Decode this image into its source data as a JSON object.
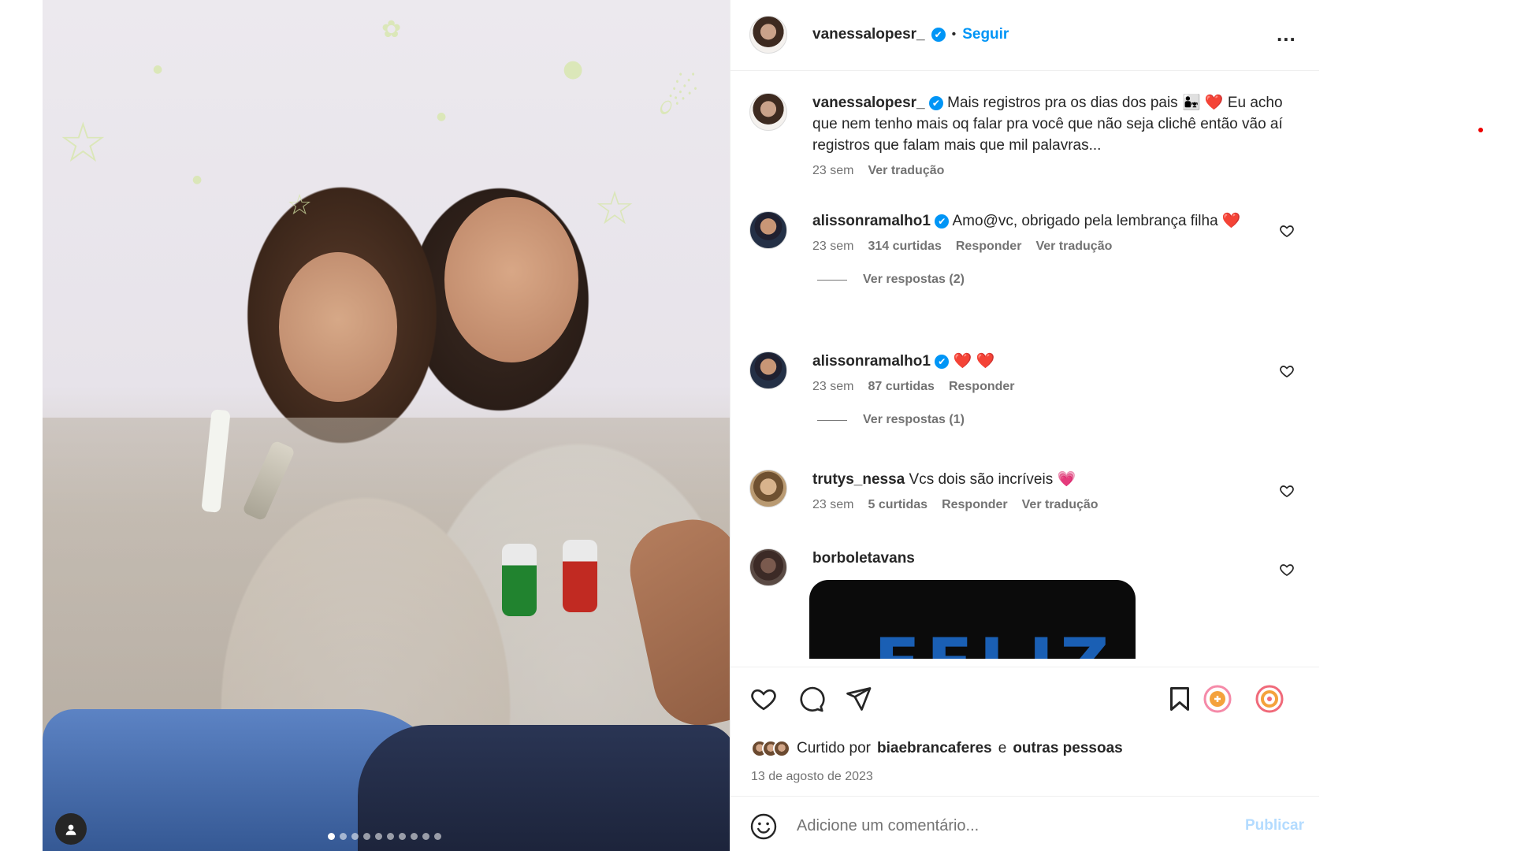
{
  "post": {
    "carousel": {
      "slide_count": 10,
      "active_index": 0
    },
    "next_button": "›",
    "user_tag_icon": "person-icon"
  },
  "header": {
    "username": "vanessalopesr_",
    "verified_mark": "✔",
    "separator": "•",
    "follow_label": "Seguir",
    "more_label": "..."
  },
  "caption": {
    "username": "vanessalopesr_",
    "text": "Mais registros pra os dias dos pais 👨‍👧 ❤️ Eu acho que nem tenho mais oq falar pra você que não seja clichê então vão aí registros que falam mais que mil palavras...",
    "time": "23 sem",
    "translate": "Ver tradução"
  },
  "comments": [
    {
      "username": "alissonramalho1",
      "text": "Amo@vc, obrigado pela lembrança filha ❤️",
      "time": "23 sem",
      "likes": "314 curtidas",
      "reply": "Responder",
      "translate": "Ver tradução",
      "view_replies": "Ver respostas (2)"
    },
    {
      "username": "alissonramalho1",
      "text": "❤️ ❤️",
      "time": "23 sem",
      "likes": "87 curtidas",
      "reply": "Responder",
      "view_replies": "Ver respostas (1)"
    },
    {
      "username": "trutys_nessa",
      "text": "Vcs dois são incríveis 💗",
      "time": "23 sem",
      "likes": "5 curtidas",
      "reply": "Responder",
      "translate": "Ver tradução"
    },
    {
      "username": "borboletavans",
      "media_text": "FELIZ"
    }
  ],
  "actions": {
    "icons": [
      "heart-icon",
      "comment-icon",
      "share-icon",
      "bookmark-icon"
    ],
    "liked_by_prefix": "Curtido por",
    "liked_by_user": "biaebrancaferes",
    "liked_by_conj": "e",
    "liked_by_others": "outras pessoas",
    "date": "13 de agosto de 2023"
  },
  "add_comment": {
    "placeholder": "Adicione um comentário...",
    "publish_label": "Publicar",
    "emoji_icon": "smiley-icon"
  },
  "colors": {
    "accent": "#0095f6",
    "muted": "#737373",
    "text": "#262626",
    "publish_disabled": "#b3dbff"
  }
}
